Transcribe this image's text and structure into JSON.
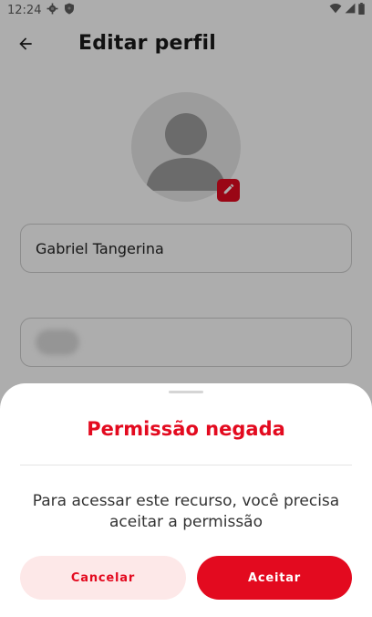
{
  "status_bar": {
    "time": "12:24",
    "icons": [
      "gear-icon",
      "shield-icon",
      "wifi-icon",
      "signal-icon",
      "battery-icon"
    ]
  },
  "app_bar": {
    "title": "Editar perfil",
    "back_icon": "arrow-left-icon"
  },
  "profile": {
    "avatar_icon": "person-placeholder-icon",
    "edit_icon": "pencil-icon",
    "name_value": "Gabriel Tangerina"
  },
  "dialog": {
    "title": "Permissão negada",
    "message": "Para acessar este recurso, você precisa aceitar a permissão",
    "cancel_label": "Cancelar",
    "accept_label": "Aceitar"
  },
  "colors": {
    "accent": "#e30a1f",
    "cancel_bg": "#fde8e8",
    "scrim": "rgba(0,0,0,0.32)"
  }
}
